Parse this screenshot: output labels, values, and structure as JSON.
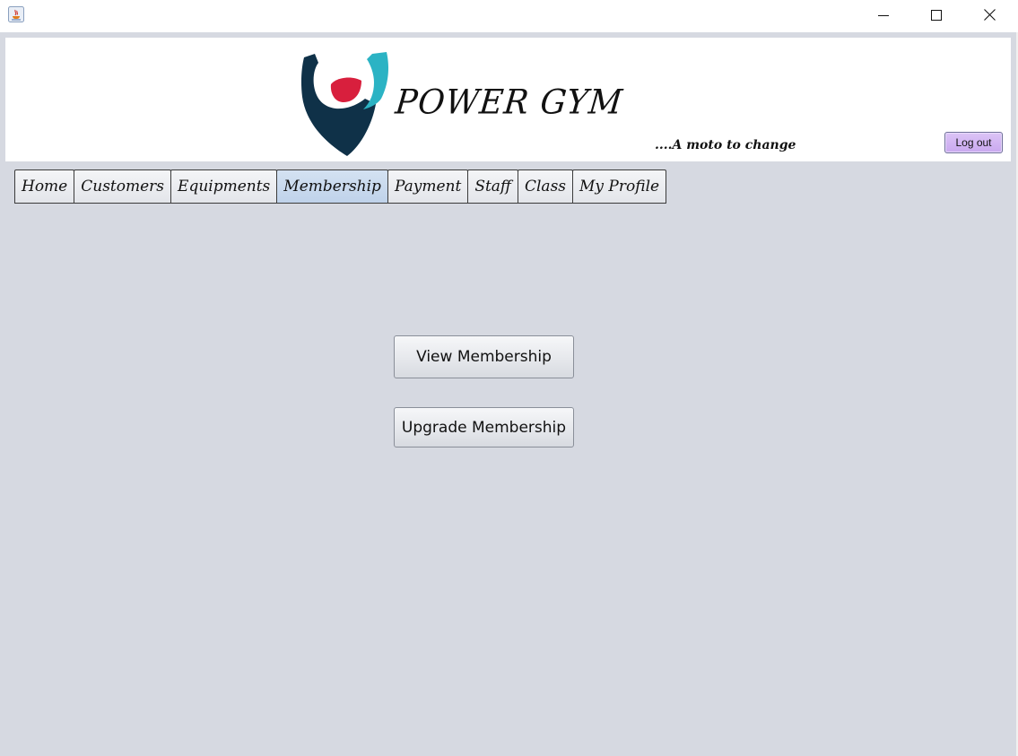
{
  "window": {
    "icons": {
      "app": "java-app-icon",
      "minimize": "minimize-icon",
      "maximize": "maximize-icon",
      "close": "close-icon"
    }
  },
  "banner": {
    "title": "POWER GYM",
    "tagline": "....A moto to change",
    "logo": "power-gym-logo",
    "logout_label": "Log out"
  },
  "tabs": [
    {
      "label": "Home"
    },
    {
      "label": "Customers"
    },
    {
      "label": "Equipments"
    },
    {
      "label": "Membership",
      "selected": true
    },
    {
      "label": "Payment"
    },
    {
      "label": "Staff"
    },
    {
      "label": "Class"
    },
    {
      "label": "My Profile"
    }
  ],
  "main": {
    "view_membership_label": "View Membership",
    "upgrade_membership_label": "Upgrade Membership"
  },
  "colors": {
    "background": "#d6d9e1",
    "logout_button": "#cfb1f2",
    "active_tab": "#c6d7ec",
    "logo_dark": "#0f3148",
    "logo_teal": "#2bb3c4",
    "logo_red": "#d81f3d"
  }
}
